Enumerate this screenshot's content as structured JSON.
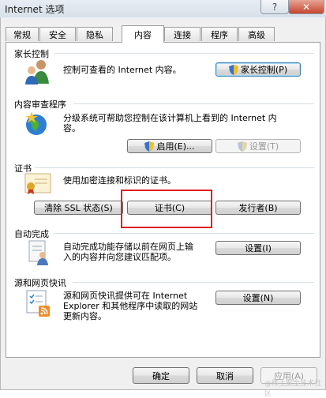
{
  "window": {
    "title": "Internet 选项",
    "help_label": "?",
    "close_label": "✕"
  },
  "tabs": [
    {
      "label": "常规"
    },
    {
      "label": "安全"
    },
    {
      "label": "隐私"
    },
    {
      "label": "内容",
      "active": true
    },
    {
      "label": "连接"
    },
    {
      "label": "程序"
    },
    {
      "label": "高级"
    }
  ],
  "parental": {
    "title": "家长控制",
    "description": "控制可查看的 Internet 内容。",
    "button": "家长控制(P)",
    "icon": "family-users-icon"
  },
  "advisor": {
    "title": "内容审查程序",
    "description_line1": "分级系统可帮助您控制在该计算机上看到的 Internet 内",
    "description_line2": "容。",
    "enable_button": "启用(E)...",
    "settings_button": "设置(T)",
    "icon": "globe-star-icon"
  },
  "certificates": {
    "title": "证书",
    "description": "使用加密连接和标识的证书。",
    "clear_ssl_button": "清除 SSL 状态(S)",
    "certificates_button": "证书(C)",
    "publishers_button": "发行者(B)",
    "icon": "certificate-icon"
  },
  "autocomplete": {
    "title": "自动完成",
    "description_line1": "自动完成功能存储以前在网页上输",
    "description_line2": "入的内容并向您建议匹配项。",
    "settings_button": "设置(I)",
    "icon": "form-user-icon"
  },
  "feeds": {
    "title": "源和网页快讯",
    "description_line1": "源和网页快讯提供可在 Internet",
    "description_line2": "Explorer 和其他程序中读取的网站",
    "description_line3": "更新内容。",
    "settings_button": "设置(N)",
    "icon": "feed-list-icon"
  },
  "footer": {
    "ok": "确定",
    "cancel": "取消",
    "apply": "应用(A)"
  },
  "watermark": "@稀土掘金技术社区",
  "colors": {
    "highlight": "#e0201f",
    "focus_border": "#3c7fb1",
    "close_button": "#c7452f"
  }
}
